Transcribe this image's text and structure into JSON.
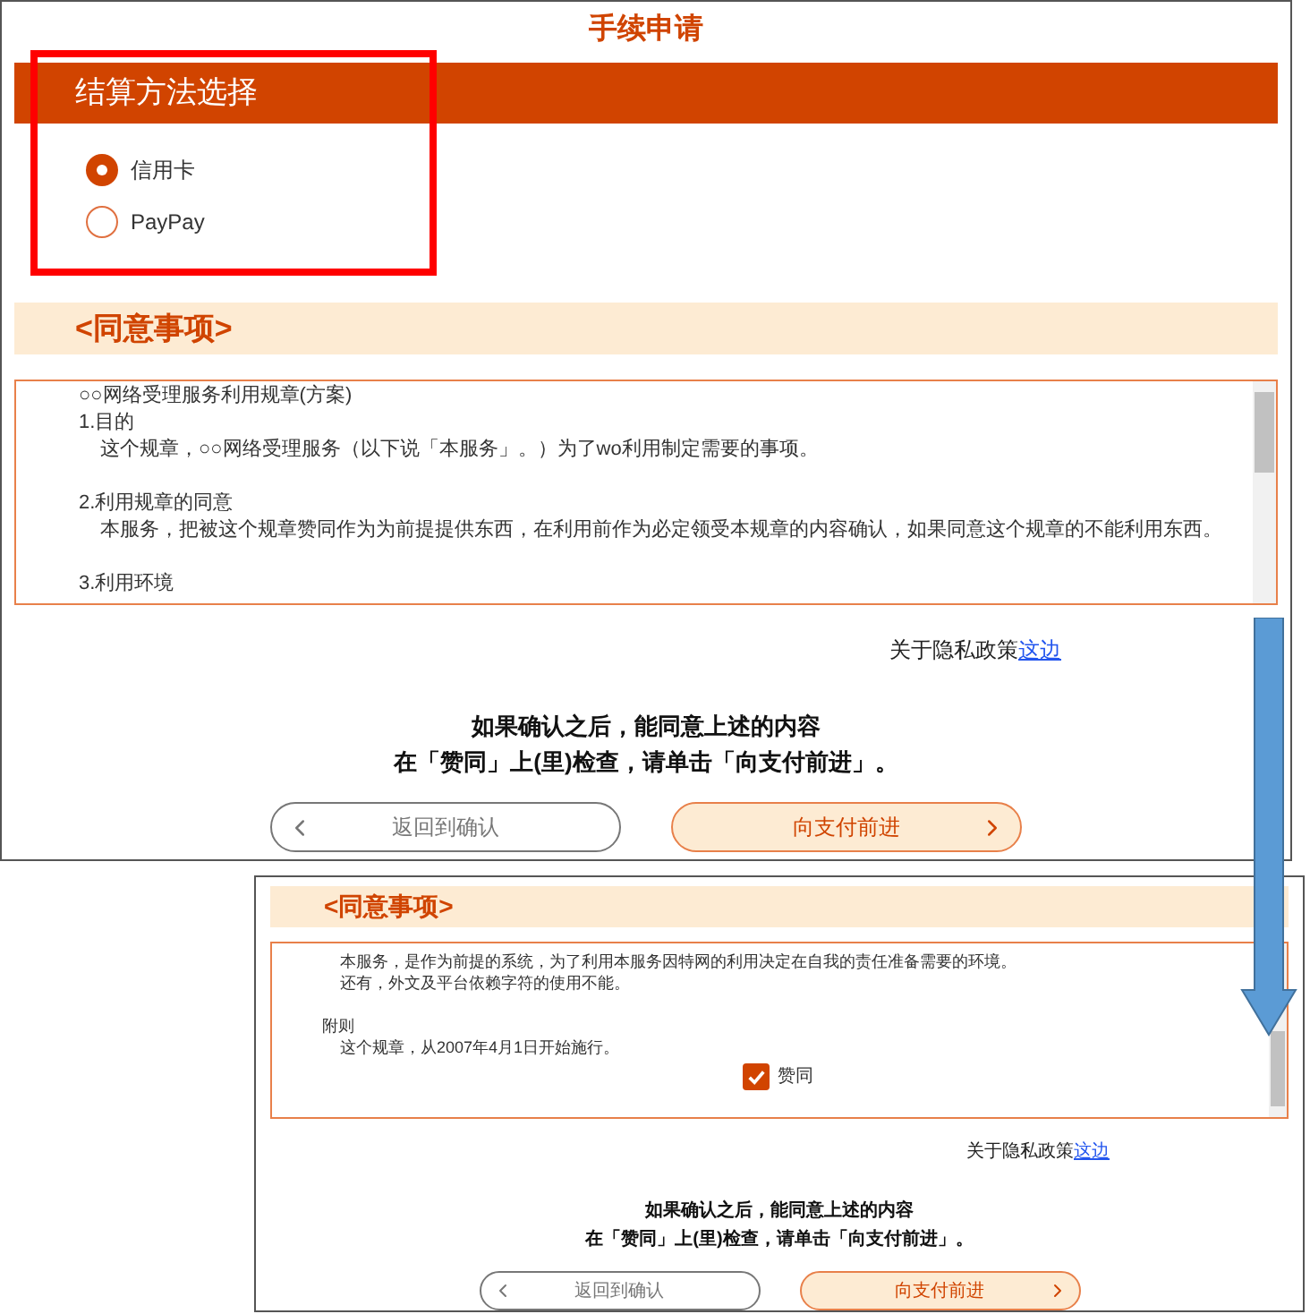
{
  "page_title": "手续申请",
  "payment": {
    "heading": "结算方法选择",
    "options": [
      {
        "label": "信用卡",
        "selected": true
      },
      {
        "label": "PayPay",
        "selected": false
      }
    ]
  },
  "consent": {
    "heading": "<同意事项>",
    "lines": [
      {
        "kind": "title",
        "text": "○○网络受理服务利用规章(方案)"
      },
      {
        "kind": "heading",
        "text": "1.目的"
      },
      {
        "kind": "body",
        "text": "这个规章，○○网络受理服务（以下说「本服务」。）为了wo利用制定需要的事项。"
      },
      {
        "kind": "blank"
      },
      {
        "kind": "heading",
        "text": "2.利用规章的同意"
      },
      {
        "kind": "body",
        "text": "本服务，把被这个规章赞同作为为前提提供东西，在利用前作为必定领受本规章的内容确认，如果同意这个规章的不能利用东西。"
      },
      {
        "kind": "blank"
      },
      {
        "kind": "heading",
        "text": "3.利用环境"
      }
    ]
  },
  "privacy": {
    "text": "关于隐私政策",
    "link": "这边"
  },
  "instructions": [
    "如果确认之后，能同意上述的内容",
    "在「赞同」上(里)检查，请单击「向支付前进」。"
  ],
  "buttons": [
    {
      "kind": "back",
      "label": "返回到确认"
    },
    {
      "kind": "forward",
      "label": "向支付前进"
    }
  ],
  "scrolled_view": {
    "heading": "<同意事项>",
    "lines": [
      {
        "kind": "body",
        "text": "本服务，是作为前提的系统，为了利用本服务因特网的利用决定在自我的责任准备需要的环境。"
      },
      {
        "kind": "body",
        "text": "还有，外文及平台依赖字符的使用不能。"
      },
      {
        "kind": "blank"
      },
      {
        "kind": "heading",
        "text": "附则"
      },
      {
        "kind": "body",
        "text": "这个规章，从2007年4月1日开始施行。"
      }
    ],
    "agree": {
      "label": "赞同",
      "checked": true
    },
    "privacy": {
      "text": "关于隐私政策",
      "link": "这边"
    },
    "instructions": [
      "如果确认之后，能同意上述的内容",
      "在「赞同」上(里)检查，请单击「向支付前进」。"
    ],
    "buttons": [
      {
        "kind": "back",
        "label": "返回到确认"
      },
      {
        "kind": "forward",
        "label": "向支付前进"
      }
    ]
  }
}
